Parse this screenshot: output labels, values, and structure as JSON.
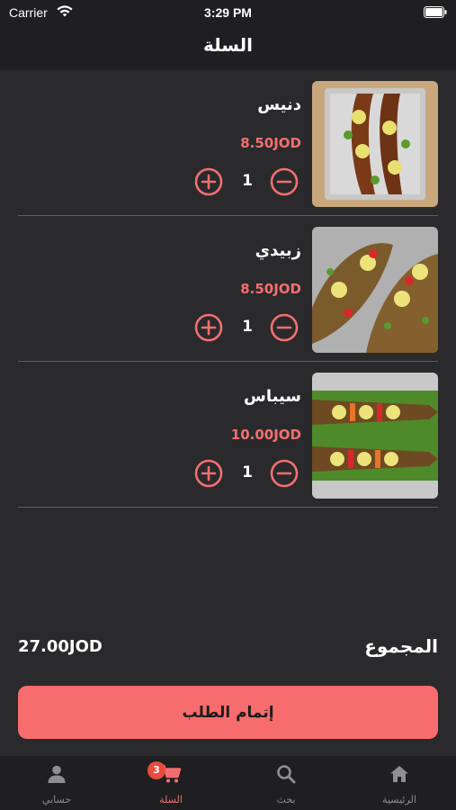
{
  "status_bar": {
    "carrier": "Carrier",
    "time": "3:29 PM"
  },
  "header": {
    "title": "السلة"
  },
  "cart": {
    "items": [
      {
        "name": "دنيس",
        "price": "8.50JOD",
        "quantity": "1",
        "image": "grilled-fish-on-tray"
      },
      {
        "name": "زبيدي",
        "price": "8.50JOD",
        "quantity": "1",
        "image": "grilled-fish-with-lemon"
      },
      {
        "name": "سيباس",
        "price": "10.00JOD",
        "quantity": "1",
        "image": "grilled-fish-with-peppers"
      }
    ],
    "total_label": "المجموع",
    "total_value": "27.00JOD"
  },
  "checkout": {
    "label": "إتمام الطلب"
  },
  "tab_bar": {
    "tabs": [
      {
        "label": "الرئيسية",
        "icon": "home-icon"
      },
      {
        "label": "بحث",
        "icon": "search-icon"
      },
      {
        "label": "السلة",
        "icon": "cart-icon",
        "badge": "3",
        "active": true
      },
      {
        "label": "حسابي",
        "icon": "user-icon"
      }
    ]
  },
  "colors": {
    "accent": "#f76c6c",
    "background": "#2a2a2c",
    "bar": "#1f1f21"
  }
}
